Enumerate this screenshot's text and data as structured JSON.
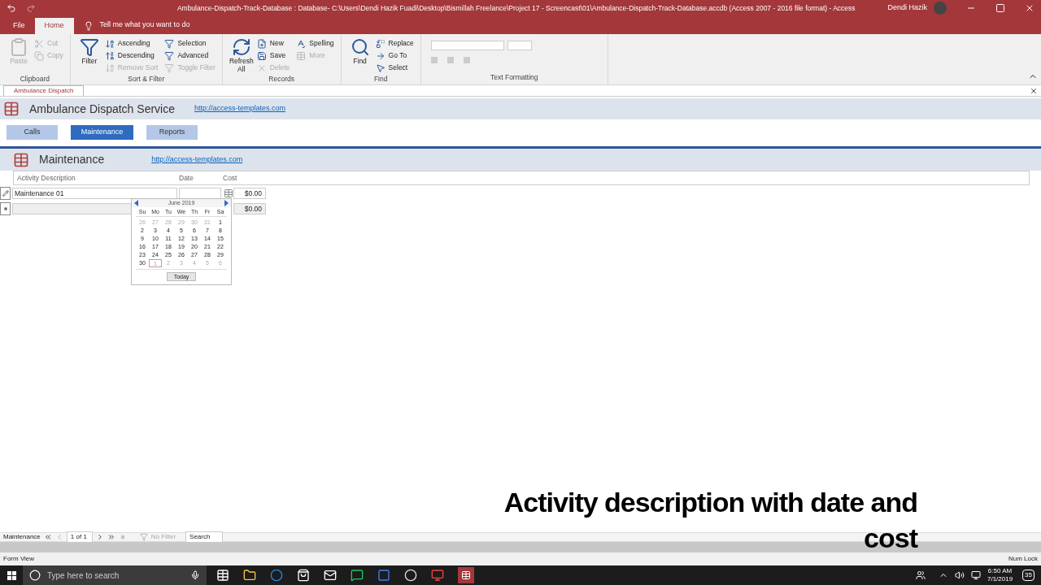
{
  "title_bar": {
    "title": "Ambulance-Dispatch-Track-Database : Database- C:\\Users\\Dendi Hazik Fuadi\\Desktop\\Bismillah Freelance\\Project 17 - Screencast\\01\\Ambulance-Dispatch-Track-Database.accdb (Access 2007 - 2016 file format)  -  Access",
    "user": "Dendi Hazik"
  },
  "ribbon_tabs": [
    {
      "label": "File",
      "selected": false
    },
    {
      "label": "Home",
      "selected": true
    }
  ],
  "tell_me": "Tell me what you want to do",
  "ribbon_groups": [
    {
      "label": "Clipboard",
      "big": [
        {
          "label": "Paste",
          "disabled": true
        }
      ],
      "items": [
        {
          "label": "Cut",
          "disabled": true
        },
        {
          "label": "Copy",
          "disabled": true
        }
      ]
    },
    {
      "label": "Sort & Filter",
      "big": [
        {
          "label": "Filter",
          "disabled": false
        }
      ],
      "items": [
        {
          "label": "Ascending",
          "disabled": false
        },
        {
          "label": "Descending",
          "disabled": false
        },
        {
          "label": "Remove Sort",
          "disabled": true
        },
        {
          "label": "Selection",
          "disabled": false
        },
        {
          "label": "Advanced",
          "disabled": false
        },
        {
          "label": "Toggle Filter",
          "disabled": true
        }
      ]
    },
    {
      "label": "Records",
      "big": [
        {
          "label": "Refresh All",
          "disabled": false
        }
      ],
      "items": [
        {
          "label": "New",
          "disabled": false
        },
        {
          "label": "Save",
          "disabled": false
        },
        {
          "label": "Delete",
          "disabled": true
        },
        {
          "label": "Spelling",
          "disabled": false
        },
        {
          "label": "More",
          "disabled": true
        }
      ]
    },
    {
      "label": "Find",
      "big": [
        {
          "label": "Find",
          "disabled": false
        }
      ],
      "items": [
        {
          "label": "Replace",
          "disabled": false
        },
        {
          "label": "Go To",
          "disabled": false
        },
        {
          "label": "Select",
          "disabled": false
        }
      ]
    },
    {
      "label": "Text Formatting"
    }
  ],
  "document_tab": "Ambulance Dispatch",
  "header": {
    "title": "Ambulance Dispatch Service",
    "link": "http://access-templates.com"
  },
  "nav_buttons": [
    {
      "label": "Calls",
      "selected": false
    },
    {
      "label": "Maintenance",
      "selected": true
    },
    {
      "label": "Reports",
      "selected": false
    }
  ],
  "form": {
    "title": "Maintenance",
    "link": "http://access-templates.com",
    "columns": [
      "Activity Description",
      "Date",
      "Cost"
    ],
    "rows": [
      {
        "kind": "current",
        "description": "Maintenance 01",
        "cost": "$0.00"
      },
      {
        "kind": "new",
        "cost": "$0.00"
      }
    ]
  },
  "calendar": {
    "month": "June 2019",
    "weekdays": [
      "Su",
      "Mo",
      "Tu",
      "We",
      "Th",
      "Fr",
      "Sa"
    ],
    "days": [
      {
        "label": "26",
        "other_month": true,
        "selected": false
      },
      {
        "label": "27",
        "other_month": true,
        "selected": false
      },
      {
        "label": "28",
        "other_month": true,
        "selected": false
      },
      {
        "label": "29",
        "other_month": true,
        "selected": false
      },
      {
        "label": "30",
        "other_month": true,
        "selected": false
      },
      {
        "label": "31",
        "other_month": true,
        "selected": false
      },
      {
        "label": "1",
        "other_month": false,
        "selected": false
      },
      {
        "label": "2",
        "other_month": false,
        "selected": false
      },
      {
        "label": "3",
        "other_month": false,
        "selected": false
      },
      {
        "label": "4",
        "other_month": false,
        "selected": false
      },
      {
        "label": "5",
        "other_month": false,
        "selected": false
      },
      {
        "label": "6",
        "other_month": false,
        "selected": false
      },
      {
        "label": "7",
        "other_month": false,
        "selected": false
      },
      {
        "label": "8",
        "other_month": false,
        "selected": false
      },
      {
        "label": "9",
        "other_month": false,
        "selected": false
      },
      {
        "label": "10",
        "other_month": false,
        "selected": false
      },
      {
        "label": "11",
        "other_month": false,
        "selected": false
      },
      {
        "label": "12",
        "other_month": false,
        "selected": false
      },
      {
        "label": "13",
        "other_month": false,
        "selected": false
      },
      {
        "label": "14",
        "other_month": false,
        "selected": false
      },
      {
        "label": "15",
        "other_month": false,
        "selected": false
      },
      {
        "label": "16",
        "other_month": false,
        "selected": false
      },
      {
        "label": "17",
        "other_month": false,
        "selected": false
      },
      {
        "label": "18",
        "other_month": false,
        "selected": false
      },
      {
        "label": "19",
        "other_month": false,
        "selected": false
      },
      {
        "label": "20",
        "other_month": false,
        "selected": false
      },
      {
        "label": "21",
        "other_month": false,
        "selected": false
      },
      {
        "label": "22",
        "other_month": false,
        "selected": false
      },
      {
        "label": "23",
        "other_month": false,
        "selected": false
      },
      {
        "label": "24",
        "other_month": false,
        "selected": false
      },
      {
        "label": "25",
        "other_month": false,
        "selected": false
      },
      {
        "label": "26",
        "other_month": false,
        "selected": false
      },
      {
        "label": "27",
        "other_month": false,
        "selected": false
      },
      {
        "label": "28",
        "other_month": false,
        "selected": false
      },
      {
        "label": "29",
        "other_month": false,
        "selected": false
      },
      {
        "label": "30",
        "other_month": false,
        "selected": false
      },
      {
        "label": "1",
        "other_month": true,
        "selected": true
      },
      {
        "label": "2",
        "other_month": true,
        "selected": false
      },
      {
        "label": "3",
        "other_month": true,
        "selected": false
      },
      {
        "label": "4",
        "other_month": true,
        "selected": false
      },
      {
        "label": "5",
        "other_month": true,
        "selected": false
      },
      {
        "label": "6",
        "other_month": true,
        "selected": false
      }
    ],
    "today_label": "Today"
  },
  "record_nav": {
    "table": "Maintenance",
    "position": "1 of 1",
    "filter": "No Filter",
    "search": "Search"
  },
  "status_bar": {
    "view": "Form View",
    "indicator": "Num Lock"
  },
  "caption": [
    "Activity description with date and",
    "cost"
  ],
  "taskbar": {
    "search_placeholder": "Type here to search",
    "time": "6:50 AM",
    "date": "7/1/2019",
    "notifications": "35"
  }
}
